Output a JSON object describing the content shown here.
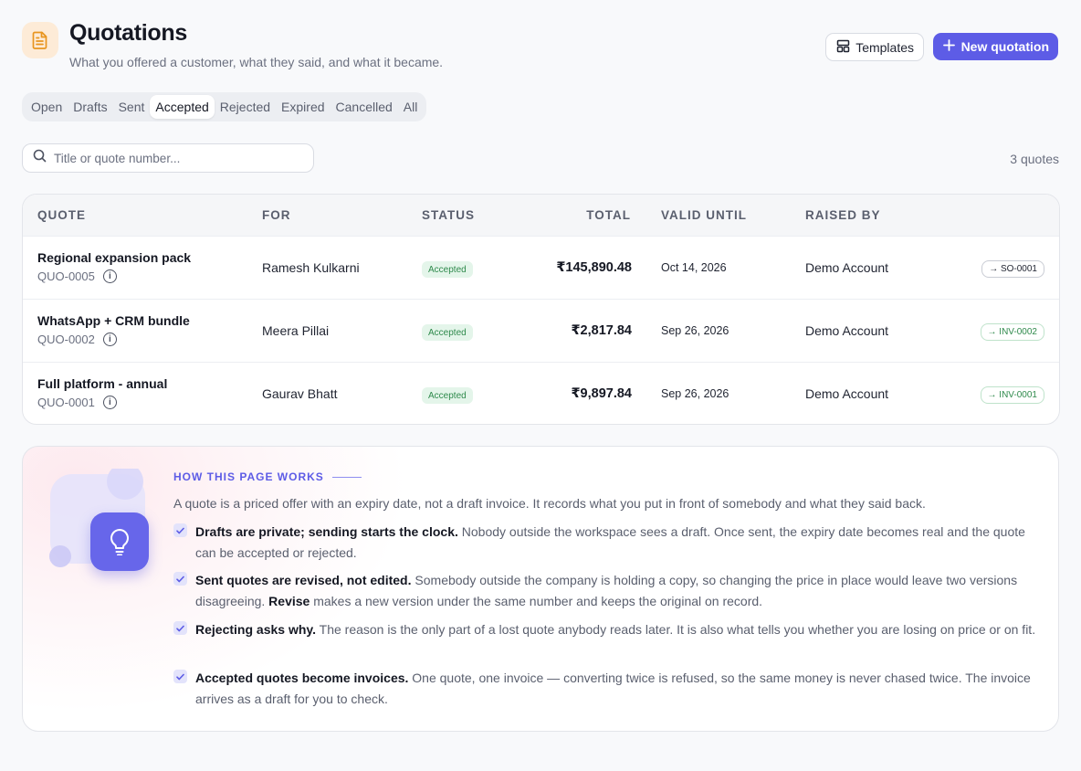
{
  "header": {
    "icon": "document-icon",
    "title": "Quotations",
    "subtitle": "What you offered a customer, what they said, and what it became.",
    "templates_label": "Templates",
    "new_label": "New quotation"
  },
  "tabs": [
    {
      "label": "Open",
      "active": false
    },
    {
      "label": "Drafts",
      "active": false
    },
    {
      "label": "Sent",
      "active": false
    },
    {
      "label": "Accepted",
      "active": true
    },
    {
      "label": "Rejected",
      "active": false
    },
    {
      "label": "Expired",
      "active": false
    },
    {
      "label": "Cancelled",
      "active": false
    },
    {
      "label": "All",
      "active": false
    }
  ],
  "search": {
    "placeholder": "Title or quote number..."
  },
  "count_label": "3 quotes",
  "table": {
    "columns": {
      "quote": "QUOTE",
      "for": "FOR",
      "status": "STATUS",
      "total": "TOTAL",
      "valid_until": "VALID UNTIL",
      "raised_by": "RAISED BY"
    },
    "rows": [
      {
        "title": "Regional expansion pack",
        "number": "QUO-0005",
        "customer": "Ramesh Kulkarni",
        "status": "Accepted",
        "total": "₹145,890.48",
        "valid_until": "Oct 14, 2026",
        "raised_by": "Demo Account",
        "link": "→ SO-0001",
        "link_type": "so"
      },
      {
        "title": "WhatsApp + CRM bundle",
        "number": "QUO-0002",
        "customer": "Meera Pillai",
        "status": "Accepted",
        "total": "₹2,817.84",
        "valid_until": "Sep 26, 2026",
        "raised_by": "Demo Account",
        "link": "→ INV-0002",
        "link_type": "inv"
      },
      {
        "title": "Full platform - annual",
        "number": "QUO-0001",
        "customer": "Gaurav Bhatt",
        "status": "Accepted",
        "total": "₹9,897.84",
        "valid_until": "Sep 26, 2026",
        "raised_by": "Demo Account",
        "link": "→ INV-0001",
        "link_type": "inv"
      }
    ]
  },
  "info": {
    "label": "HOW THIS PAGE WORKS",
    "intro": "A quote is a priced offer with an expiry date, not a draft invoice. It records what you put in front of somebody and what they said back.",
    "points": [
      {
        "bold": "Drafts are private; sending starts the clock.",
        "text": " Nobody outside the workspace sees a draft. Once sent, the expiry date becomes real and the quote can be accepted or rejected.",
        "bold2": "",
        "text2": ""
      },
      {
        "bold": "Sent quotes are revised, not edited.",
        "text": " Somebody outside the company is holding a copy, so changing the price in place would leave two versions disagreeing. ",
        "bold2": "Revise",
        "text2": " makes a new version under the same number and keeps the original on record."
      },
      {
        "bold": "Rejecting asks why.",
        "text": " The reason is the only part of a lost quote anybody reads later. It is also what tells you whether you are losing on price or on fit.",
        "bold2": "",
        "text2": ""
      },
      {
        "bold": "Accepted quotes become invoices.",
        "text": " One quote, one invoice — converting twice is refused, so the same money is never chased twice. The invoice arrives as a draft for you to check.",
        "bold2": "",
        "text2": ""
      }
    ]
  },
  "colors": {
    "accent": "#5d5ce6",
    "success": "#2f8a4c",
    "success_bg": "#e4f5ea",
    "page_icon_bg": "#fdebd7"
  }
}
